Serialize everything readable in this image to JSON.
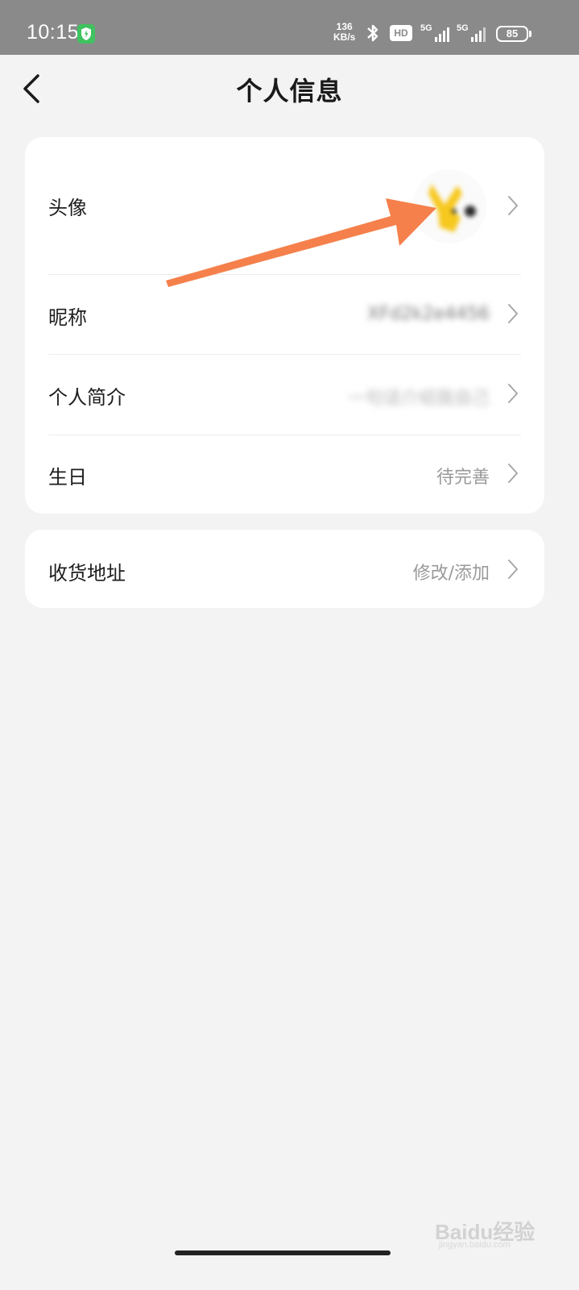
{
  "status_bar": {
    "time": "10:15",
    "net_speed_value": "136",
    "net_speed_unit": "KB/s",
    "hd_label": "HD",
    "signal_1_label": "5G",
    "signal_2_label": "5G",
    "battery_level": "85"
  },
  "nav": {
    "title": "个人信息"
  },
  "profile_card": {
    "rows": [
      {
        "label": "头像",
        "value": ""
      },
      {
        "label": "昵称",
        "value": "XFd2k2e4456"
      },
      {
        "label": "个人简介",
        "value": "一句话介绍我自己"
      },
      {
        "label": "生日",
        "value": "待完善"
      }
    ]
  },
  "address_card": {
    "label": "收货地址",
    "value": "修改/添加"
  },
  "watermark": {
    "brand": "Baidu经验",
    "url": "jingyan.baidu.com"
  },
  "colors": {
    "status_bar_bg": "#8a8a8a",
    "page_bg": "#f3f3f3",
    "card_bg": "#ffffff",
    "annotation_arrow": "#f5804b",
    "avatar_yellow": "#f7c81e"
  }
}
